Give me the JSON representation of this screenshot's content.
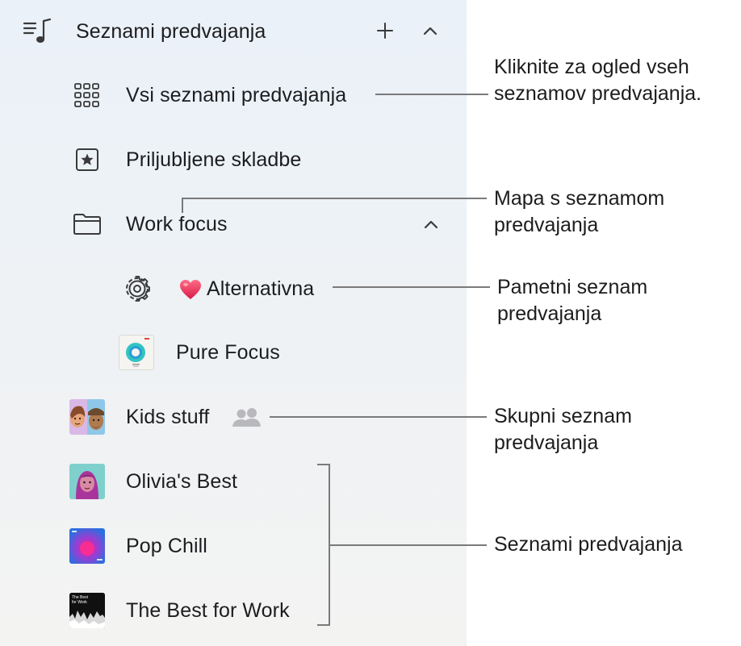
{
  "sidebar": {
    "header": {
      "title": "Seznami predvajanja",
      "icon": "playlist-music-icon",
      "add_icon": "plus-icon",
      "collapse_icon": "chevron-up-icon"
    },
    "items": [
      {
        "label": "Vsi seznami predvajanja",
        "icon": "grid-icon"
      },
      {
        "label": "Priljubljene skladbe",
        "icon": "star-square-icon"
      },
      {
        "label": "Work focus",
        "icon": "folder-icon",
        "expanded_icon": "chevron-up-icon"
      },
      {
        "label": "Alternativna",
        "icon": "gear-icon",
        "emoji": "❤️",
        "emoji_icon": "heart-icon"
      },
      {
        "label": "Pure Focus",
        "icon": "artwork-pure-focus"
      },
      {
        "label": "Kids stuff",
        "icon": "artwork-kids-stuff",
        "shared_icon": "people-icon"
      },
      {
        "label": "Olivia's Best",
        "icon": "artwork-olivias-best"
      },
      {
        "label": "Pop Chill",
        "icon": "artwork-pop-chill"
      },
      {
        "label": "The Best for Work",
        "icon": "artwork-best-for-work",
        "artwork_text": "The Best for Work"
      }
    ]
  },
  "callouts": {
    "all_playlists": [
      "Kliknite za ogled vseh",
      "seznamov predvajanja."
    ],
    "folder": [
      "Mapa s seznamom",
      "predvajanja"
    ],
    "smart": [
      "Pametni seznam",
      "predvajanja"
    ],
    "shared": [
      "Skupni seznam",
      "predvajanja"
    ],
    "playlists": [
      "Seznami predvajanja"
    ]
  },
  "colors": {
    "line": "#7a7a7a",
    "heart": "#e8365d",
    "icon": "#3a3a3c"
  }
}
